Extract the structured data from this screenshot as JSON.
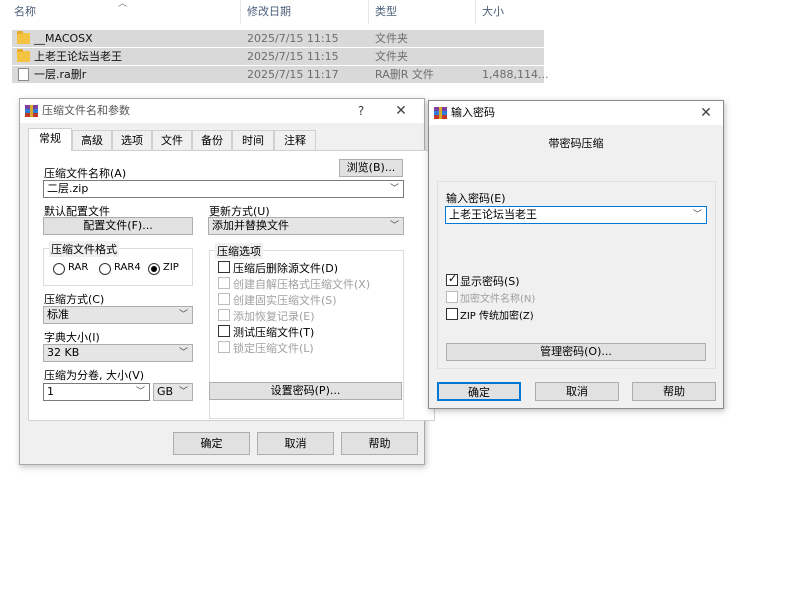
{
  "explorer": {
    "columns": {
      "name": "名称",
      "date": "修改日期",
      "type": "类型",
      "size": "大小"
    },
    "rows": [
      {
        "icon": "folder-icon",
        "name": "__MACOSX",
        "date": "2025/7/15 11:15",
        "type": "文件夹",
        "size": ""
      },
      {
        "icon": "folder-icon",
        "name": "上老王论坛当老王",
        "date": "2025/7/15 11:15",
        "type": "文件夹",
        "size": ""
      },
      {
        "icon": "file-icon",
        "name": "一层.ra删r",
        "date": "2025/7/15 11:17",
        "type": "RA删R 文件",
        "size": "1,488,114..."
      }
    ]
  },
  "archive_dialog": {
    "title": "压缩文件名和参数",
    "help_glyph": "?",
    "close_glyph": "✕",
    "tabs": [
      "常规",
      "高级",
      "选项",
      "文件",
      "备份",
      "时间",
      "注释"
    ],
    "active_tab": "常规",
    "archive_name_label": "压缩文件名称(A)",
    "browse_button": "浏览(B)...",
    "archive_name_value": "二层.zip",
    "default_profile_label": "默认配置文件",
    "profiles_button": "配置文件(F)...",
    "update_mode_label": "更新方式(U)",
    "update_mode_value": "添加并替换文件",
    "format_group_title": "压缩文件格式",
    "formats": [
      "RAR",
      "RAR4",
      "ZIP"
    ],
    "selected_format": "ZIP",
    "options_group_title": "压缩选项",
    "options": [
      {
        "label": "压缩后删除源文件(D)",
        "checked": false,
        "enabled": true
      },
      {
        "label": "创建自解压格式压缩文件(X)",
        "checked": false,
        "enabled": false
      },
      {
        "label": "创建固实压缩文件(S)",
        "checked": false,
        "enabled": false
      },
      {
        "label": "添加恢复记录(E)",
        "checked": false,
        "enabled": false
      },
      {
        "label": "测试压缩文件(T)",
        "checked": false,
        "enabled": true
      },
      {
        "label": "锁定压缩文件(L)",
        "checked": false,
        "enabled": false
      }
    ],
    "method_label": "压缩方式(C)",
    "method_value": "标准",
    "dict_label": "字典大小(I)",
    "dict_value": "32 KB",
    "split_label": "压缩为分卷, 大小(V)",
    "split_value": "1",
    "split_unit": "GB",
    "set_password_button": "设置密码(P)...",
    "ok_button": "确定",
    "cancel_button": "取消",
    "help_button": "帮助"
  },
  "password_dialog": {
    "title": "输入密码",
    "close_glyph": "✕",
    "subtitle": "带密码压缩",
    "password_label": "输入密码(E)",
    "password_value": "上老王论坛当老王",
    "show_password": {
      "label": "显示密码(S)",
      "checked": true,
      "enabled": true
    },
    "encrypt_names": {
      "label": "加密文件名称(N)",
      "checked": false,
      "enabled": false
    },
    "zip_legacy": {
      "label": "ZIP 传统加密(Z)",
      "checked": false,
      "enabled": true
    },
    "manage_button": "管理密码(O)...",
    "ok_button": "确定",
    "cancel_button": "取消",
    "help_button": "帮助"
  },
  "colors": {
    "accent": "#0078d7",
    "selection_row": "#d9d9d9",
    "dialog_bg": "#f0f0f0",
    "folder": "#f5c342"
  }
}
